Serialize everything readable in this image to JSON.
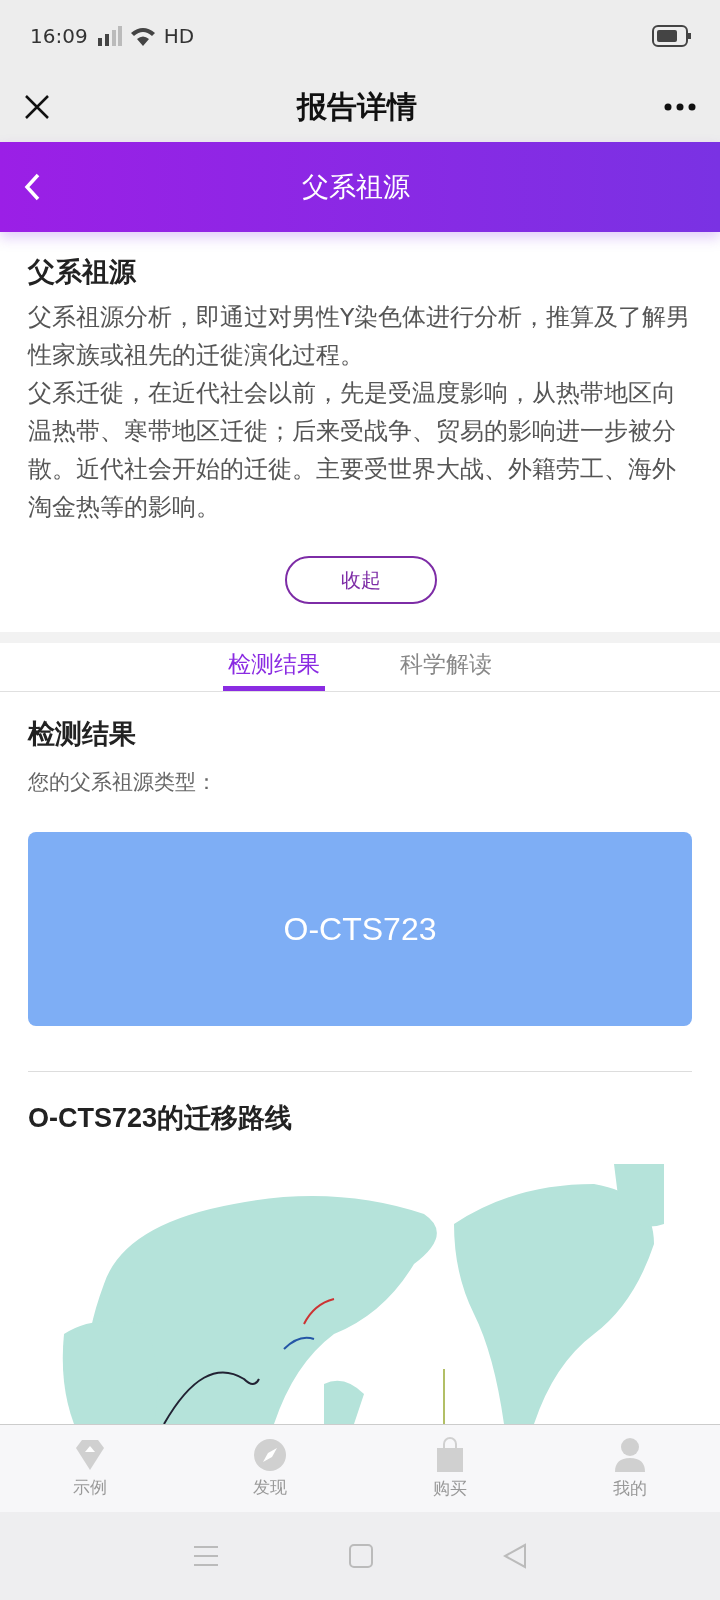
{
  "status_bar": {
    "time": "16:09",
    "network": "HD"
  },
  "title_bar": {
    "title": "报告详情"
  },
  "header": {
    "title": "父系祖源"
  },
  "intro": {
    "title": "父系祖源",
    "paragraphs": [
      "父系祖源分析，即通过对男性Y染色体进行分析，推算及了解男性家族或祖先的迁徙演化过程。",
      "父系迁徙，在近代社会以前，先是受温度影响，从热带地区向温热带、寒带地区迁徙；后来受战争、贸易的影响进一步被分散。近代社会开始的迁徙。主要受世界大战、外籍劳工、海外淘金热等的影响。"
    ],
    "collapse_button": "收起"
  },
  "tabs": [
    {
      "label": "检测结果",
      "selected": true
    },
    {
      "label": "科学解读",
      "selected": false
    }
  ],
  "result": {
    "title": "检测结果",
    "subtitle": "您的父系祖源类型：",
    "haplogroup": "O-CTS723"
  },
  "route": {
    "title": "O-CTS723的迁移路线"
  },
  "bottom_nav": [
    {
      "label": "示例"
    },
    {
      "label": "发现"
    },
    {
      "label": "购买"
    },
    {
      "label": "我的"
    }
  ]
}
